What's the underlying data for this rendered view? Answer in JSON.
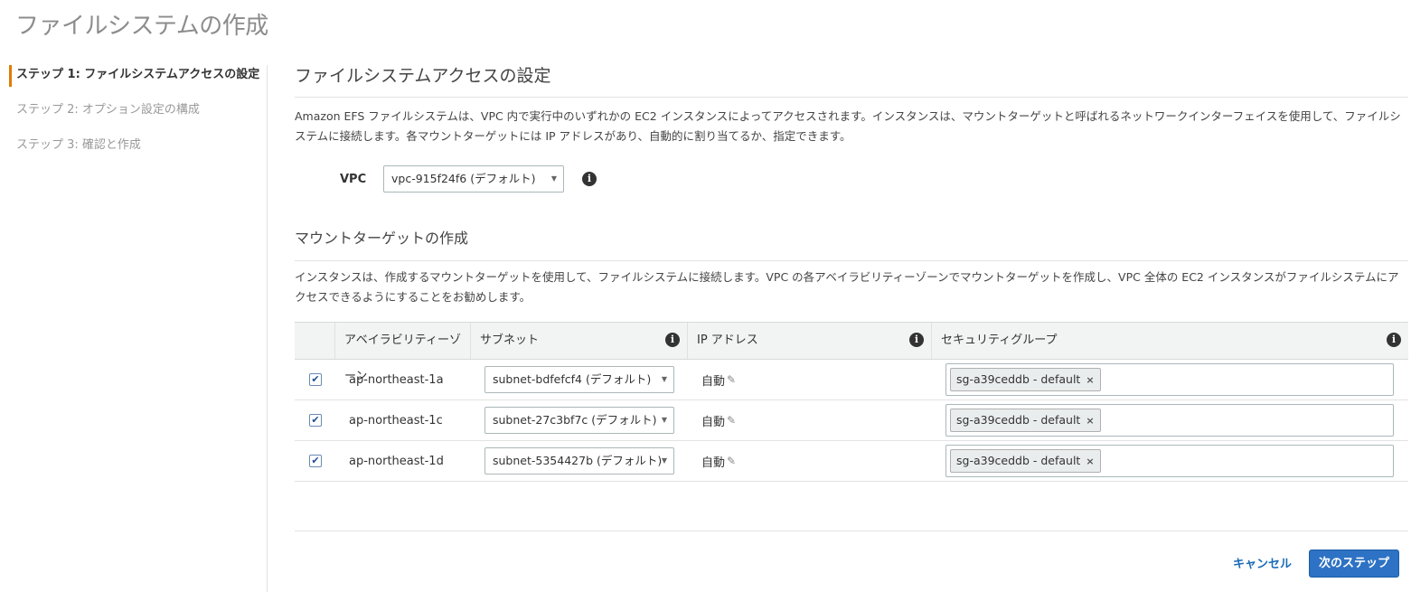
{
  "page": {
    "title": "ファイルシステムの作成"
  },
  "steps": [
    {
      "label": "ステップ 1: ファイルシステムアクセスの設定",
      "active": true
    },
    {
      "label": "ステップ 2: オプション設定の構成",
      "active": false
    },
    {
      "label": "ステップ 3: 確認と作成",
      "active": false
    }
  ],
  "access": {
    "title": "ファイルシステムアクセスの設定",
    "description": "Amazon EFS ファイルシステムは、VPC 内で実行中のいずれかの EC2 インスタンスによってアクセスされます。インスタンスは、マウントターゲットと呼ばれるネットワークインターフェイスを使用して、ファイルシステムに接続します。各マウントターゲットには IP アドレスがあり、自動的に割り当てるか、指定できます。",
    "vpc_label": "VPC",
    "vpc_value": "vpc-915f24f6 (デフォルト)"
  },
  "mount": {
    "title": "マウントターゲットの作成",
    "description": "インスタンスは、作成するマウントターゲットを使用して、ファイルシステムに接続します。VPC の各アベイラビリティーゾーンでマウントターゲットを作成し、VPC 全体の EC2 インスタンスがファイルシステムにアクセスできるようにすることをお勧めします。",
    "columns": {
      "zone": "アベイラビリティーゾーン",
      "subnet": "サブネット",
      "ip": "IP アドレス",
      "sg": "セキュリティグループ"
    },
    "rows": [
      {
        "zone": "ap-northeast-1a",
        "subnet": "subnet-bdfefcf4 (デフォルト)",
        "ip": "自動",
        "sg": "sg-a39ceddb - default"
      },
      {
        "zone": "ap-northeast-1c",
        "subnet": "subnet-27c3bf7c (デフォルト)",
        "ip": "自動",
        "sg": "sg-a39ceddb - default"
      },
      {
        "zone": "ap-northeast-1d",
        "subnet": "subnet-5354427b (デフォルト)",
        "ip": "自動",
        "sg": "sg-a39ceddb - default"
      }
    ]
  },
  "footer": {
    "cancel": "キャンセル",
    "next": "次のステップ"
  },
  "colors": {
    "accent": "#e07b00",
    "primary_button": "#2d72c4",
    "link": "#1a6bb8"
  },
  "icons": {
    "info": "info-icon",
    "caret": "caret-down-icon",
    "pencil": "pencil-icon",
    "check": "check-icon",
    "remove": "remove-x-icon"
  }
}
